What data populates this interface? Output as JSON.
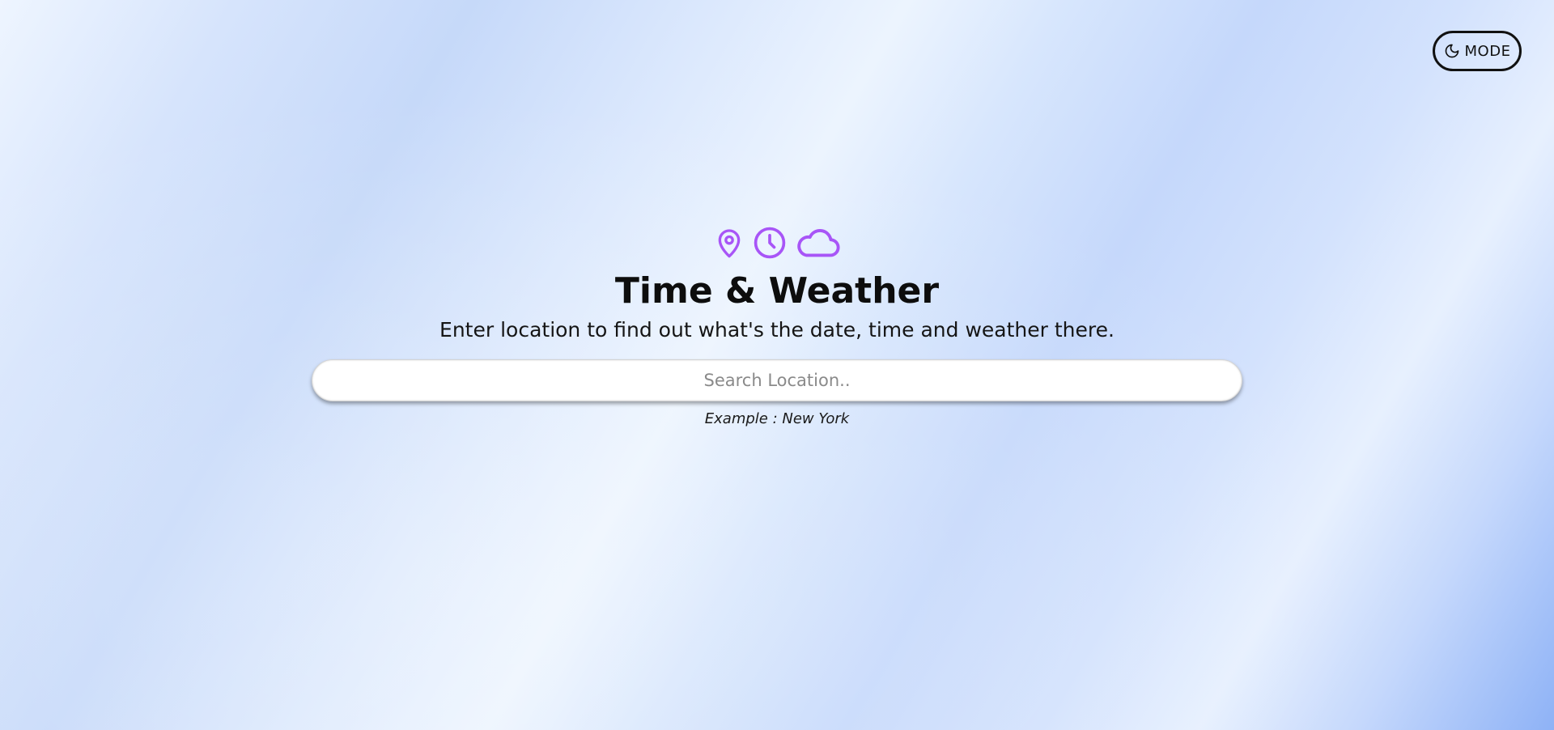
{
  "header": {
    "mode_button_label": "MODE",
    "mode_icon": "moon-icon"
  },
  "hero": {
    "icons": [
      "map-pin-icon",
      "clock-icon",
      "cloud-icon"
    ],
    "icon_color": "#a855f7",
    "title": "Time & Weather",
    "subtitle": "Enter location to find out what's the date, time and weather there."
  },
  "search": {
    "placeholder": "Search Location..",
    "value": "",
    "example": "Example : New York"
  },
  "theme": {
    "background_accent": "#8eb2f6",
    "text_color": "#111111"
  }
}
